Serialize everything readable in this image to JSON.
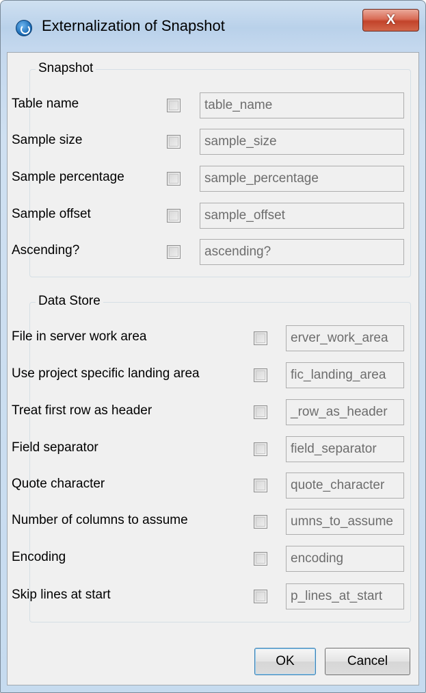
{
  "window": {
    "title": "Externalization of Snapshot",
    "close_label": "X"
  },
  "snapshot": {
    "title": "Snapshot",
    "rows": [
      {
        "label": "Table name",
        "value": "table_name"
      },
      {
        "label": "Sample size",
        "value": "sample_size"
      },
      {
        "label": "Sample percentage",
        "value": "sample_percentage"
      },
      {
        "label": "Sample offset",
        "value": "sample_offset"
      },
      {
        "label": "Ascending?",
        "value": "ascending?"
      }
    ]
  },
  "data_store": {
    "title": "Data Store",
    "rows": [
      {
        "label": "File in server work area",
        "value": "erver_work_area"
      },
      {
        "label": "Use project specific landing area",
        "value": "fic_landing_area"
      },
      {
        "label": "Treat first row as header",
        "value": "_row_as_header"
      },
      {
        "label": "Field separator",
        "value": "field_separator"
      },
      {
        "label": "Quote character",
        "value": "quote_character"
      },
      {
        "label": "Number of columns to assume",
        "value": "umns_to_assume"
      },
      {
        "label": "Encoding",
        "value": "encoding"
      },
      {
        "label": "Skip lines at start",
        "value": "p_lines_at_start"
      }
    ]
  },
  "buttons": {
    "ok": "OK",
    "cancel": "Cancel"
  }
}
